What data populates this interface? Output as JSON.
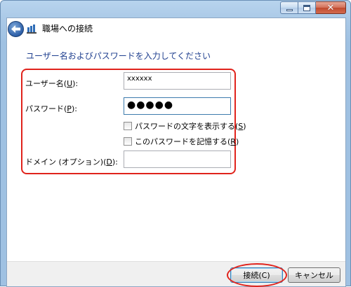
{
  "window": {
    "title": "職場への接続"
  },
  "heading": "ユーザー名およびパスワードを入力してください",
  "form": {
    "username": {
      "label_pre": "ユーザー名(",
      "label_key": "U",
      "label_post": "):",
      "value": "xxxxxx"
    },
    "password": {
      "label_pre": "パスワード(",
      "label_key": "P",
      "label_post": "):",
      "value": "●●●●●"
    },
    "show_chars": {
      "label_pre": "パスワードの文字を表示する(",
      "label_key": "S",
      "label_post": ")",
      "checked": false
    },
    "remember": {
      "label_pre": "このパスワードを記憶する(",
      "label_key": "R",
      "label_post": ")",
      "checked": false
    },
    "domain": {
      "label_pre": "ドメイン (オプション)(",
      "label_key": "D",
      "label_post": "):",
      "value": ""
    }
  },
  "buttons": {
    "connect": "接続(C)",
    "cancel": "キャンセル"
  },
  "icons": {
    "back": "back-arrow-icon",
    "network": "network-icon",
    "minimize": "minimize-icon",
    "maximize": "maximize-icon",
    "close": "close-icon"
  },
  "colors": {
    "heading": "#1f3f8f",
    "highlight": "#e0231c",
    "window_frame": "#a9c8e6"
  }
}
